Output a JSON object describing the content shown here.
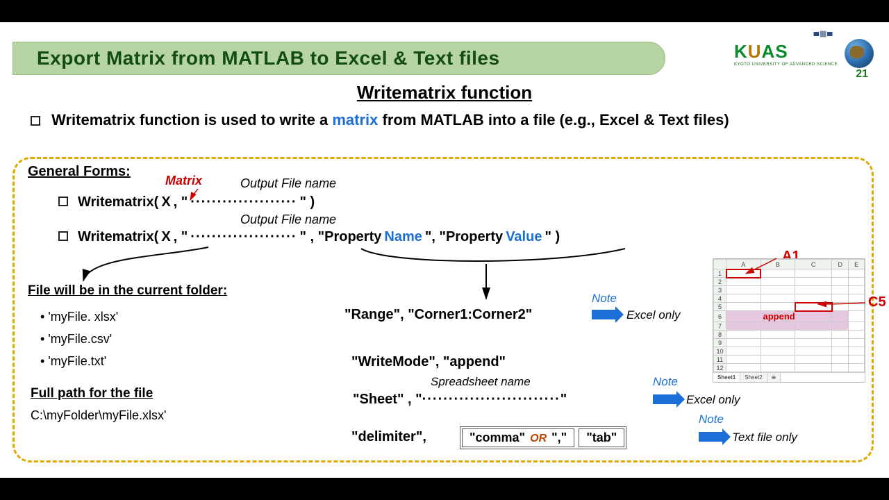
{
  "header": {
    "title": "Export Matrix from MATLAB to Excel & Text files",
    "logo": "KUAS",
    "logo_sub": "KYOTO UNIVERSITY OF ADVANCED SCIENCE",
    "page_number": "21"
  },
  "subtitle": {
    "main": "Writematrix",
    "suffix": " function"
  },
  "intro": {
    "prefix": "Writematrix function is used to write a ",
    "matrix_word": "matrix",
    "suffix": " from MATLAB into a file (e.g., Excel & Text files)"
  },
  "general_forms": {
    "heading": "General Forms:",
    "matrix_var_label": "Matrix",
    "output_file_label": "Output File name",
    "form1": {
      "func": "Writematrix( ",
      "var": "X",
      "sep1": ", \"",
      "dots": "····················",
      "end": "\" )"
    },
    "form2": {
      "func": "Writematrix( ",
      "var": "X",
      "sep1": ", \"",
      "dots": "····················",
      "mid": "\" , \"Property",
      "name_word": "Name",
      "mid2": "\", \"Property",
      "value_word": "Value",
      "end": "\" )"
    }
  },
  "folder": {
    "heading": "File will be in the current folder:",
    "files": [
      "'myFile. xlsx'",
      "'myFile.csv'",
      "'myFile.txt'"
    ]
  },
  "fullpath": {
    "heading": "Full path for the file",
    "value": "C:\\myFolder\\myFile.xlsx'"
  },
  "props": {
    "range": "\"Range\", \"Corner1:Corner2\"",
    "writemode": "\"WriteMode\", \"append\"",
    "sheet_prefix": "\"Sheet\" , \"",
    "sheet_dots": "··························",
    "sheet_suffix": "\"",
    "sheet_hint": "Spreadsheet name",
    "delimiter_key": "\"delimiter\", ",
    "delim_a": "\"comma\"",
    "delim_or": "OR",
    "delim_b": "\",\"",
    "delim_tab": "\"tab\"",
    "note": "Note",
    "excel_only": "Excel only",
    "text_only": "Text file only"
  },
  "excel": {
    "cols": [
      "A",
      "B",
      "C",
      "D",
      "E"
    ],
    "rows": [
      "1",
      "2",
      "3",
      "4",
      "5",
      "6",
      "7",
      "8",
      "9",
      "10",
      "11",
      "12"
    ],
    "a1": "A1",
    "c5": "C5",
    "append": "append",
    "sheet1": "Sheet1",
    "sheet2": "Sheet2"
  }
}
